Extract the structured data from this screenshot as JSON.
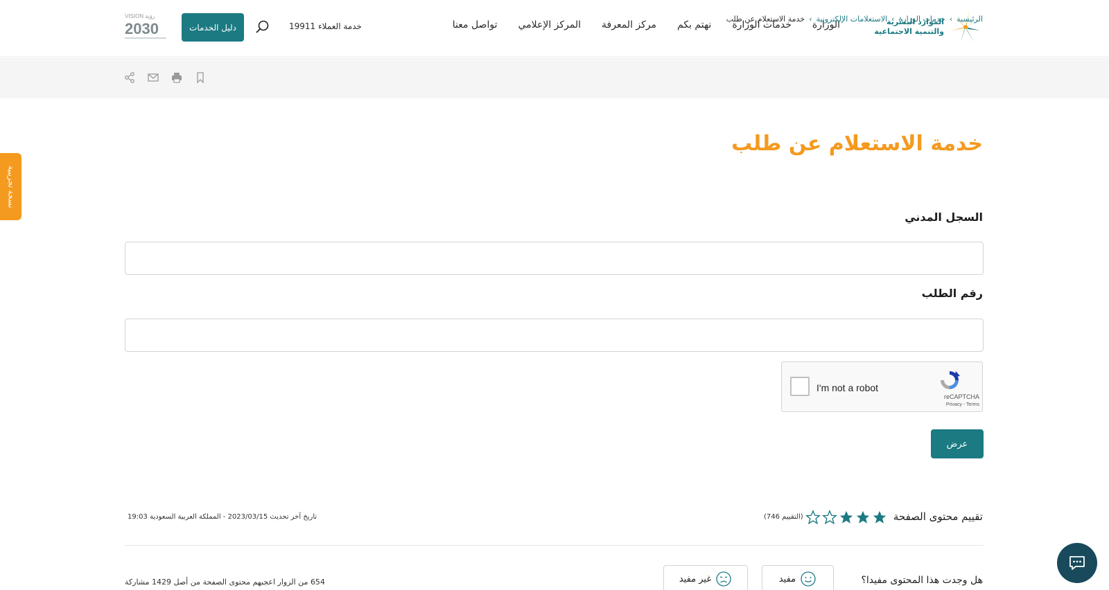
{
  "header": {
    "logo_line1": "الموارد البشرية",
    "logo_line2": "والتنمية الاجتماعية",
    "nav": [
      "الوزارة",
      "خدمات الوزارة",
      "نهتم بكم",
      "مركز المعرفة",
      "المركز الإعلامي",
      "تواصل معنا"
    ],
    "hotline": "خدمة العملاء 19911",
    "services_button": "دليل الخدمات",
    "vision_text": "2030",
    "vision_label": "VISION رؤية"
  },
  "breadcrumb": {
    "home": "الرئيسية",
    "level1": "خدمات الوزارة",
    "level2": "الاستعلامات الإلكترونية",
    "current": "خدمة الاستعلام عن طلب"
  },
  "side_tab": "نسخة تجريبية",
  "main": {
    "title": "خدمة الاستعلام عن طلب",
    "field1_label": "السجل المدني",
    "field1_value": "",
    "field2_label": "رقم الطلب",
    "field2_value": "",
    "submit": "عرض"
  },
  "captcha": {
    "label": "I'm not a robot",
    "brand": "reCAPTCHA",
    "terms": "Privacy - Terms"
  },
  "rating": {
    "label": "تقييم محتوى الصفحة",
    "count": "(التقييم 746)",
    "stars_filled": 3,
    "stars_total": 5,
    "updated": "تاريخ آخر تحديث  2023/03/15  - المملكة العربية السعودية  19:03"
  },
  "feedback": {
    "question": "هل وجدت هذا المحتوى مفيدا؟",
    "useful": "مفيد",
    "not_useful": "غير مفيد",
    "stat": "654 من الزوار اعجبهم محتوى الصفحة من أصل 1429 مشاركة"
  },
  "colors": {
    "primary": "#1b7a82",
    "accent": "#f49a1f",
    "chat": "#184a5c"
  }
}
